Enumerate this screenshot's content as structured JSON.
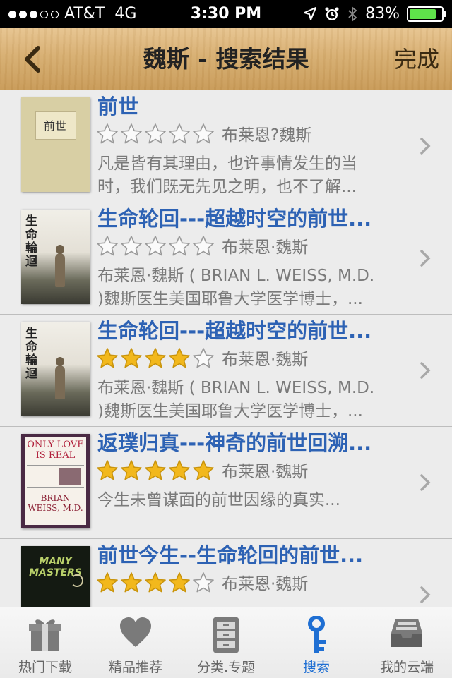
{
  "status": {
    "carrier": "AT&T",
    "network": "4G",
    "time": "3:30 PM",
    "battery": "83%",
    "battery_level": 0.83,
    "signal_bars": 3
  },
  "nav": {
    "title": "魏斯 - 搜索结果",
    "done_label": "完成",
    "back_icon": "chevron-left-icon"
  },
  "results": [
    {
      "title": "前世",
      "rating": 0,
      "author": "布莱恩?魏斯",
      "desc_line1": "凡是皆有其理由，也许事情发生的当",
      "desc_line2": "时，我们既无先见之明，也不了解...",
      "cover_text": "前世"
    },
    {
      "title": "生命轮回---超越时空的前世...",
      "rating": 0,
      "author": "布莱恩·魏斯",
      "desc_line1": "布莱恩·魏斯 ( BRIAN L. WEISS, M.D.",
      "desc_line2": ")魏斯医生美国耶鲁大学医学博士，...",
      "cover_text": "生命輪迴"
    },
    {
      "title": "生命轮回---超越时空的前世...",
      "rating": 4,
      "author": "布莱恩·魏斯",
      "desc_line1": "布莱恩·魏斯 ( BRIAN L. WEISS, M.D.",
      "desc_line2": ")魏斯医生美国耶鲁大学医学博士，...",
      "cover_text": "生命輪迴"
    },
    {
      "title": "返璞归真---神奇的前世回溯...",
      "rating": 5,
      "author": "布莱恩·魏斯",
      "desc_line1": "今生未曾谋面的前世因缘的真实...",
      "desc_line2": "",
      "cover_text": "ONLY LOVE IS REAL"
    },
    {
      "title": "前世今生--生命轮回的前世...",
      "rating": 4,
      "author": "布莱恩·魏斯",
      "desc_line1": "",
      "desc_line2": "",
      "cover_text": "MANY MASTERS"
    }
  ],
  "tabs": [
    {
      "label": "热门下载",
      "icon": "gift-icon"
    },
    {
      "label": "精品推荐",
      "icon": "heart-icon"
    },
    {
      "label": "分类.专题",
      "icon": "cabinet-icon"
    },
    {
      "label": "搜索",
      "icon": "key-icon"
    },
    {
      "label": "我的云端",
      "icon": "inbox-icon"
    }
  ],
  "colors": {
    "title_blue": "#2d62b4",
    "star_gold": "#f2b81c",
    "tab_active": "#1f6fd3"
  }
}
